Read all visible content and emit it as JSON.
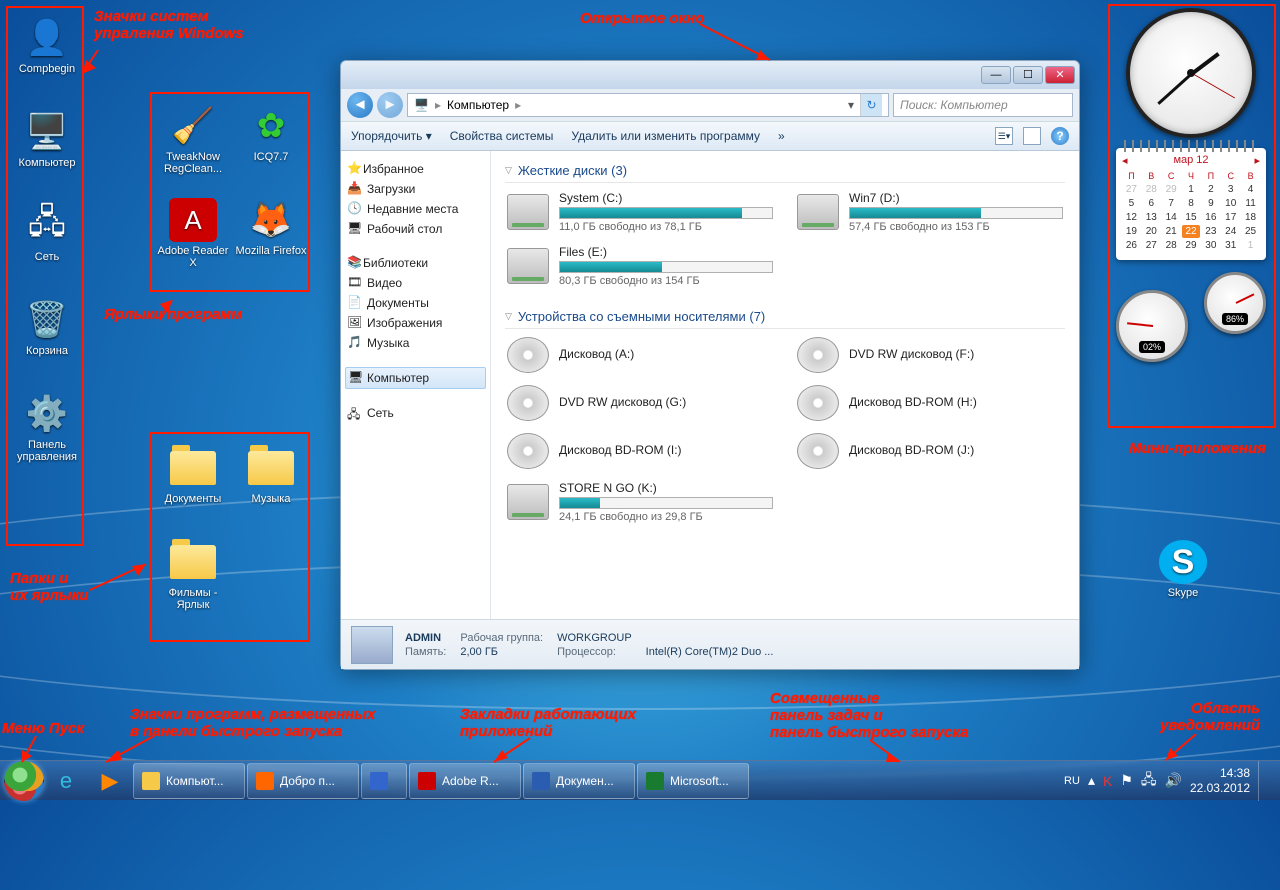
{
  "annotations": {
    "system_icons": "Значки систем\nупраления Windows",
    "open_window": "Открытое окно",
    "shortcuts": "Ярлыки программ",
    "folders": "Папки и\nих ярлыки",
    "start_menu": "Меню Пуск",
    "quick_launch": "Значки программ, размещенных\nв панели быстрого запуска",
    "running_apps": "Закладки работающих\nприложений",
    "taskbar_combined": "Совмещенные\nпанель задач и\nпанель быстрого запуска",
    "gadgets": "Мини-приложения",
    "notif_area": "Область\nуведомлений"
  },
  "desktop": {
    "system": [
      {
        "name": "Compbegin"
      },
      {
        "name": "Компьютер"
      },
      {
        "name": "Сеть"
      },
      {
        "name": "Корзина"
      },
      {
        "name": "Панель\nуправления"
      }
    ],
    "shortcuts": [
      {
        "name": "TweakNow RegClean..."
      },
      {
        "name": "ICQ7.7"
      },
      {
        "name": "Adobe Reader X"
      },
      {
        "name": "Mozilla Firefox"
      }
    ],
    "folders": [
      {
        "name": "Документы"
      },
      {
        "name": "Музыка"
      },
      {
        "name": "Фильмы - Ярлык"
      }
    ],
    "skype": "Skype"
  },
  "explorer": {
    "breadcrumb": [
      "Компьютер"
    ],
    "search_placeholder": "Поиск: Компьютер",
    "toolbar": [
      "Упорядочить ▾",
      "Свойства системы",
      "Удалить или изменить программу",
      "»"
    ],
    "sidebar": {
      "fav_hdr": "Избранное",
      "fav": [
        "Загрузки",
        "Недавние места",
        "Рабочий стол"
      ],
      "lib_hdr": "Библиотеки",
      "lib": [
        "Видео",
        "Документы",
        "Изображения",
        "Музыка"
      ],
      "computer": "Компьютер",
      "network": "Сеть"
    },
    "groups": {
      "hdd_hdr": "Жесткие диски (3)",
      "hdd": [
        {
          "name": "System (C:)",
          "free": "11,0 ГБ свободно из 78,1 ГБ",
          "pct": 86
        },
        {
          "name": "Win7 (D:)",
          "free": "57,4 ГБ свободно из 153 ГБ",
          "pct": 62
        },
        {
          "name": "Files (E:)",
          "free": "80,3 ГБ свободно из 154 ГБ",
          "pct": 48
        }
      ],
      "rem_hdr": "Устройства со съемными носителями (7)",
      "rem": [
        {
          "name": "Дисковод (A:)"
        },
        {
          "name": "DVD RW дисковод (F:)"
        },
        {
          "name": "DVD RW дисковод (G:)"
        },
        {
          "name": "Дисковод BD-ROM (H:)"
        },
        {
          "name": "Дисковод BD-ROM (I:)"
        },
        {
          "name": "Дисковод BD-ROM (J:)"
        },
        {
          "name": "STORE N GO (K:)",
          "free": "24,1 ГБ свободно из 29,8 ГБ",
          "pct": 19
        }
      ]
    },
    "status": {
      "admin": "ADMIN",
      "workgroup_lbl": "Рабочая группа:",
      "workgroup": "WORKGROUP",
      "mem_lbl": "Память:",
      "mem": "2,00 ГБ",
      "cpu_lbl": "Процессор:",
      "cpu": "Intel(R) Core(TM)2 Duo ..."
    }
  },
  "gadgets": {
    "calendar": {
      "month": "мар 12",
      "days": [
        "П",
        "В",
        "С",
        "Ч",
        "П",
        "С",
        "В"
      ],
      "leading_dim": [
        27,
        28,
        29
      ],
      "today": 22,
      "last": 31,
      "trailing_dim": [
        1
      ]
    },
    "cpu": "02%",
    "ram": "86%"
  },
  "taskbar": {
    "tasks": [
      {
        "label": "Компьют...",
        "icon": "explorer"
      },
      {
        "label": "Добро п...",
        "icon": "firefox"
      },
      {
        "label": "",
        "icon": "itunes"
      },
      {
        "label": "Adobe R...",
        "icon": "adobe"
      },
      {
        "label": "Докумен...",
        "icon": "word"
      },
      {
        "label": "Microsoft...",
        "icon": "excel"
      }
    ],
    "tray": {
      "lang": "RU",
      "time": "14:38",
      "date": "22.03.2012"
    }
  }
}
